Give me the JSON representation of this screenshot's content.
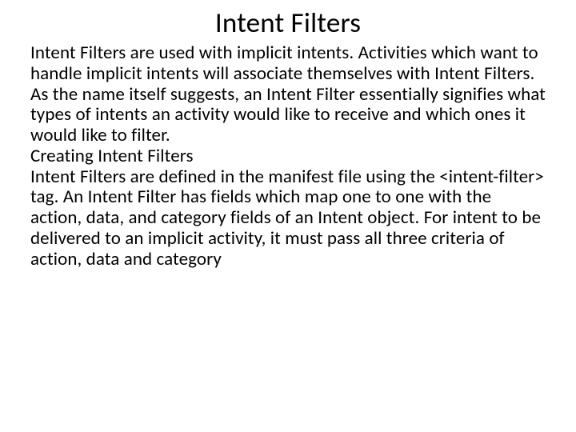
{
  "slide": {
    "title": "Intent Filters",
    "paragraph1": "Intent Filters are used with implicit intents. Activities which want to handle implicit intents will associate themselves with Intent Filters. As the name itself suggests, an Intent Filter essentially signifies what types of intents an activity would like to receive and which ones it would like to filter.",
    "subheading": "Creating Intent Filters",
    "paragraph2": "Intent Filters are defined in the manifest file using the <intent-filter> tag. An Intent Filter has fields which map one to one with the action, data, and category fields of an Intent object. For intent to be delivered to an implicit activity, it must pass all three criteria of action, data and category"
  }
}
